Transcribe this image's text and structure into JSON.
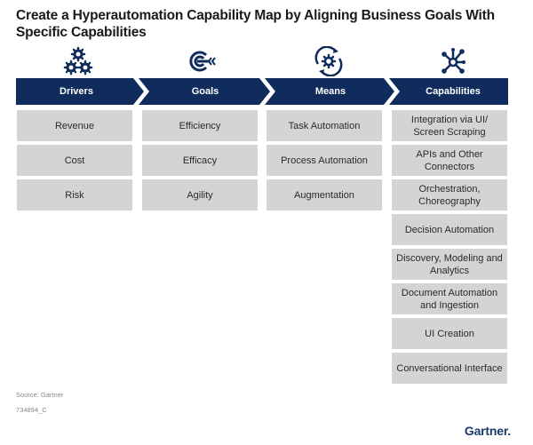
{
  "title": "Create a Hyperautomation Capability Map by Aligning Business Goals With Specific Capabilities",
  "colors": {
    "header": "#0f2c5c",
    "box": "#d4d4d4",
    "icon": "#0f2c5c",
    "brand": "#1b3a6b"
  },
  "columns": [
    {
      "label": "Drivers",
      "icon": "gears-icon",
      "items": [
        "Revenue",
        "Cost",
        "Risk"
      ]
    },
    {
      "label": "Goals",
      "icon": "target-arrow-icon",
      "items": [
        "Efficiency",
        "Efficacy",
        "Agility"
      ]
    },
    {
      "label": "Means",
      "icon": "gear-cycle-icon",
      "items": [
        "Task Automation",
        "Process Automation",
        "Augmentation"
      ]
    },
    {
      "label": "Capabilities",
      "icon": "network-hub-icon",
      "items": [
        "Integration via UI/ Screen Scraping",
        "APIs and Other Connectors",
        "Orchestration, Choreography",
        "Decision Automation",
        "Discovery, Modeling and Analytics",
        "Document Automation and Ingestion",
        "UI Creation",
        "Conversational Interface"
      ]
    }
  ],
  "footer": {
    "source": "Source: Gartner",
    "code": "734894_C",
    "logo": "Gartner."
  }
}
